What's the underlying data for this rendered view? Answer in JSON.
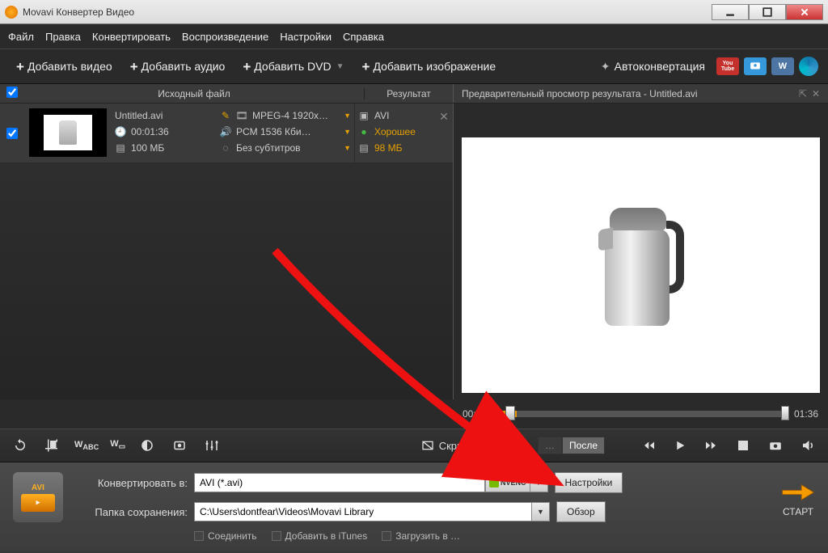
{
  "window": {
    "title": "Movavi Конвертер Видео"
  },
  "menu": {
    "file": "Файл",
    "edit": "Правка",
    "convert": "Конвертировать",
    "play": "Воспроизведение",
    "settings": "Настройки",
    "help": "Справка"
  },
  "toolbar": {
    "add_video": "Добавить видео",
    "add_audio": "Добавить аудио",
    "add_dvd": "Добавить DVD",
    "add_image": "Добавить изображение",
    "autoconvert": "Автоконвертация"
  },
  "headers": {
    "source": "Исходный файл",
    "result": "Результат",
    "preview": "Предварительный просмотр результата - Untitled.avi"
  },
  "file": {
    "name": "Untitled.avi",
    "duration": "00:01:36",
    "source_size": "100 МБ",
    "video_format": "MPEG-4 1920x…",
    "audio_format": "PCM 1536 Кби…",
    "subtitles": "Без субтитров",
    "out_container": "AVI",
    "quality": "Хорошее",
    "out_size": "98 МБ"
  },
  "timeline": {
    "start": "00:00",
    "end": "01:36"
  },
  "controls": {
    "hide_player": "Скрыть плеер",
    "after": "После"
  },
  "bottom": {
    "convert_to_label": "Конвертировать в:",
    "format_value": "AVI (*.avi)",
    "nvenc": "NVENC",
    "settings_btn": "Настройки",
    "save_to_label": "Папка сохранения:",
    "save_to_value": "C:\\Users\\dontfear\\Videos\\Movavi Library",
    "browse_btn": "Обзор",
    "join": "Соединить",
    "itunes": "Добавить в iTunes",
    "upload": "Загрузить в …",
    "device_badge": "AVI",
    "start": "СТАРТ"
  }
}
